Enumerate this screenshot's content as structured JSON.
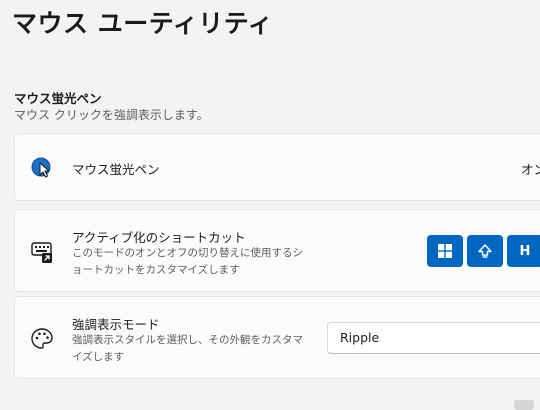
{
  "page": {
    "title": "マウス ユーティリティ"
  },
  "section": {
    "heading": "マウス蛍光ペン",
    "description": "マウス クリックを強調表示します。"
  },
  "highlighter_card": {
    "icon": "mouse-highlighter-icon",
    "title": "マウス蛍光ペン",
    "toggle_state": "オン",
    "accent_color": "#0067c0"
  },
  "shortcut_card": {
    "icon": "keyboard-shortcut-icon",
    "title": "アクティブ化のショートカット",
    "description": "このモードのオンとオフの切り替えに使用するショートカットをカスタマイズします",
    "keys": [
      {
        "name": "windows-key-icon",
        "label": ""
      },
      {
        "name": "shift-key-icon",
        "label": ""
      },
      {
        "name": "h-key",
        "label": "H"
      }
    ],
    "key_color": "#0067c0"
  },
  "style_card": {
    "icon": "palette-icon",
    "title": "強調表示モード",
    "description": "強調表示スタイルを選択し、その外観をカスタマイズします",
    "selected_value": "Ripple"
  }
}
